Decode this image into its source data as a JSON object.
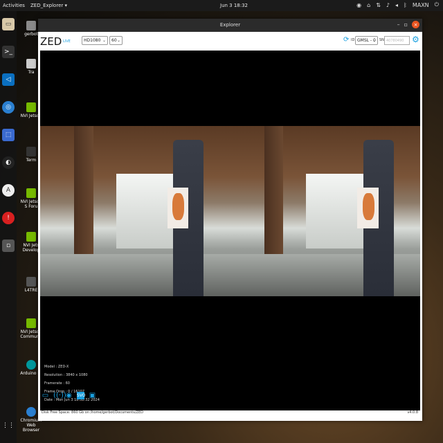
{
  "topbar": {
    "activities": "Activities",
    "app_menu": "ZED_Explorer ▾",
    "clock": "Jun 3  18:32",
    "user": "MAXN"
  },
  "desktop": {
    "items": [
      {
        "label": "gerbot"
      },
      {
        "label": "Tra"
      },
      {
        "label": "NVI Jetson"
      },
      {
        "label": "Term"
      },
      {
        "label": "NVI Jetson S Foru"
      },
      {
        "label": "NVI Jets Develop"
      },
      {
        "label": "L4TRE"
      },
      {
        "label": "NVI Jetson Communit"
      },
      {
        "label": "Arduino ID"
      },
      {
        "label": "Chromium Web Browser"
      }
    ]
  },
  "window": {
    "title": "Explorer",
    "controls": {
      "minimize": "–",
      "maximize": "▫",
      "close": "×"
    }
  },
  "toolbar": {
    "logo": "ZED",
    "live": "LIVE",
    "resolution": "HD1080",
    "fps": "60",
    "id_label": "ID",
    "camera": "GMSL - 0",
    "sn_label": "SN",
    "sn_placeholder": "40780490"
  },
  "info": {
    "model": "Model : ZED-X",
    "resolution": "Resolution : 3840 x 1080",
    "framerate": "Framerate : 60",
    "frame_drop": "Frame Drop : 0 / 16107",
    "date": "Date : Mon Jun 3 18:32:32 2024"
  },
  "footer": {
    "disk": "Disk Free Space: 860 Gb  on  /home/gerbot/Documents/ZED",
    "version": "v4.0.8"
  },
  "icons": {
    "folder": "folder-icon",
    "stream": "stream-icon",
    "record": "record-icon",
    "svo": "svo-icon",
    "snapshot": "camera-icon"
  },
  "colors": {
    "accent": "#1aa0e0",
    "close": "#e95420"
  }
}
